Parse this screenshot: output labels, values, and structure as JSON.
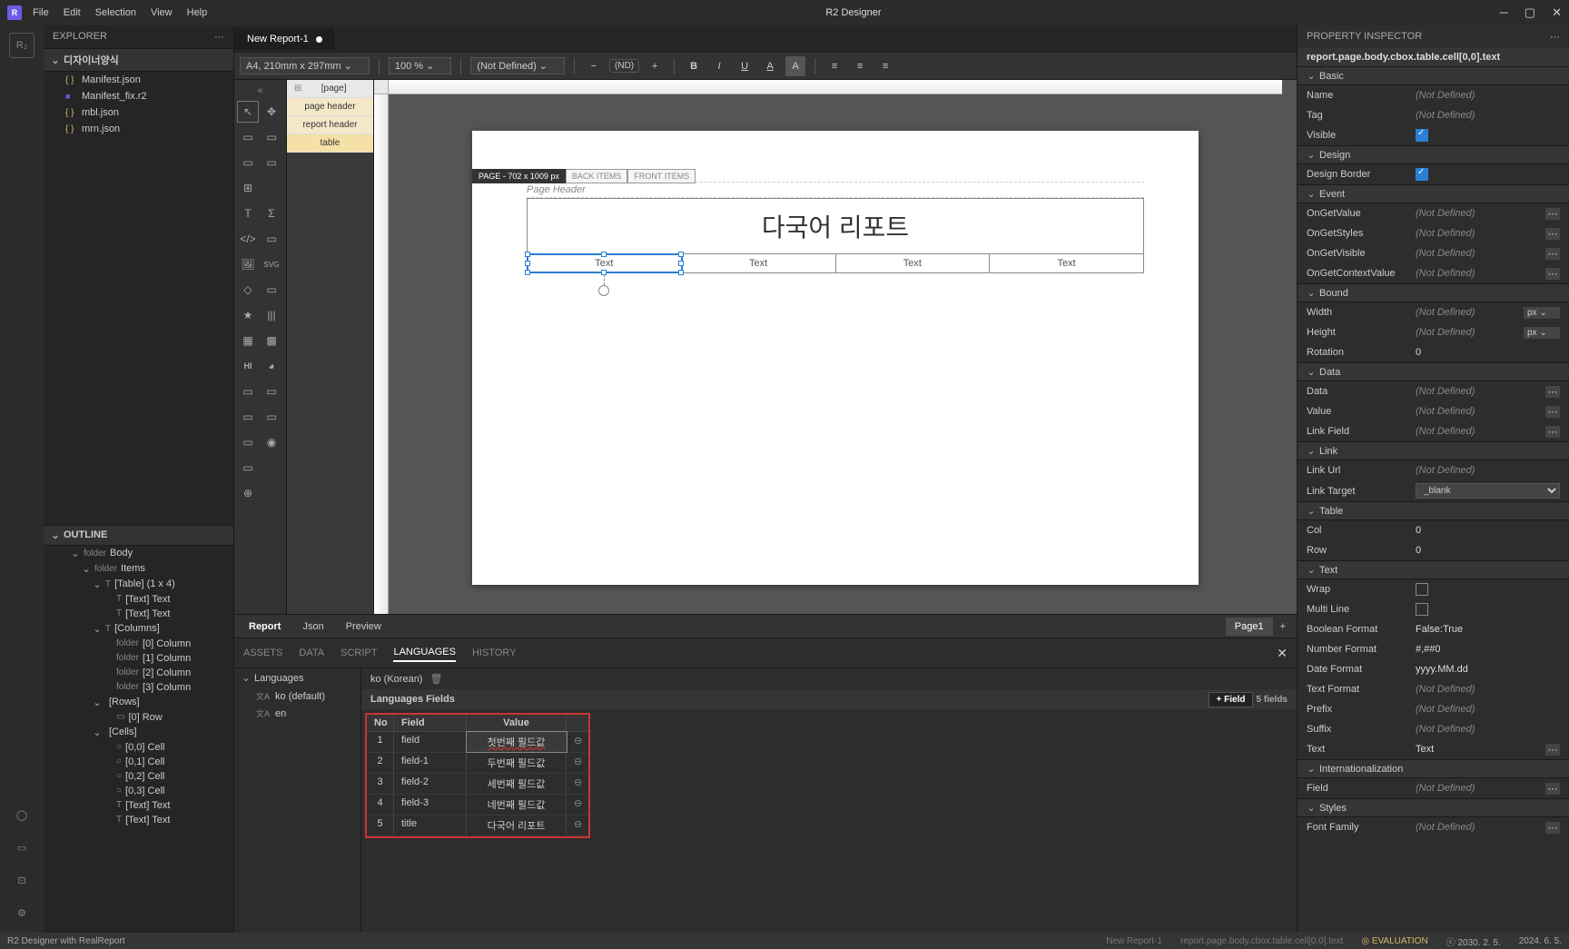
{
  "app": {
    "title": "R2 Designer"
  },
  "menu": [
    "File",
    "Edit",
    "Selection",
    "View",
    "Help"
  ],
  "tab": {
    "name": "New Report-1"
  },
  "toolbar": {
    "pageSize": "A4, 210mm x 297mm",
    "zoom": "100 %",
    "style": "(Not Defined)",
    "nd": "(ND)"
  },
  "explorer": {
    "title": "EXPLORER",
    "section": "디자이너양식",
    "files": [
      {
        "name": "Manifest.json",
        "type": "json"
      },
      {
        "name": "Manifest_fix.r2",
        "type": "r2"
      },
      {
        "name": "mbl.json",
        "type": "json"
      },
      {
        "name": "mrn.json",
        "type": "json"
      }
    ]
  },
  "outline": {
    "title": "OUTLINE",
    "items": [
      {
        "label": "Body",
        "icon": "folder",
        "ind": 2,
        "chev": true
      },
      {
        "label": "Items",
        "icon": "folder",
        "ind": 3,
        "chev": true
      },
      {
        "label": "[Table] (1 x 4)",
        "icon": "T",
        "ind": 4,
        "chev": true
      },
      {
        "label": "[Text] Text",
        "icon": "T",
        "ind": 5
      },
      {
        "label": "[Text] Text",
        "icon": "T",
        "ind": 5
      },
      {
        "label": "[Columns]",
        "icon": "T",
        "ind": 4,
        "chev": true
      },
      {
        "label": "[0] Column",
        "icon": "folder",
        "ind": 5
      },
      {
        "label": "[1] Column",
        "icon": "folder",
        "ind": 5
      },
      {
        "label": "[2] Column",
        "icon": "folder",
        "ind": 5
      },
      {
        "label": "[3] Column",
        "icon": "folder",
        "ind": 5
      },
      {
        "label": "[Rows]",
        "icon": "",
        "ind": 4,
        "chev": true
      },
      {
        "label": "[0] Row",
        "icon": "▭",
        "ind": 5
      },
      {
        "label": "[Cells]",
        "icon": "",
        "ind": 4,
        "chev": true
      },
      {
        "label": "[0,0] Cell",
        "icon": "○",
        "ind": 5
      },
      {
        "label": "[0,1] Cell",
        "icon": "○",
        "ind": 5
      },
      {
        "label": "[0,2] Cell",
        "icon": "○",
        "ind": 5
      },
      {
        "label": "[0,3] Cell",
        "icon": "○",
        "ind": 5
      },
      {
        "label": "[Text] Text",
        "icon": "T",
        "ind": 5
      },
      {
        "label": "[Text] Text",
        "icon": "T",
        "ind": 5
      }
    ]
  },
  "pageOutline": [
    "[page]",
    "page header",
    "report header",
    "table"
  ],
  "canvas": {
    "pageBadge": "PAGE - 702 x 1009 px",
    "backItems": "BACK ITEMS",
    "frontItems": "FRONT ITEMS",
    "pageHeader": "Page Header",
    "title": "다국어 리포트",
    "cells": [
      "Text",
      "Text",
      "Text",
      "Text"
    ]
  },
  "bottomTabs": {
    "tabs": [
      "Report",
      "Json",
      "Preview"
    ],
    "page": "Page1"
  },
  "bottomPanel": {
    "tabs": [
      "ASSETS",
      "DATA",
      "SCRIPT",
      "LANGUAGES",
      "HISTORY"
    ],
    "languagesHeader": "Languages",
    "langs": [
      {
        "label": "ko (default)"
      },
      {
        "label": "en"
      }
    ],
    "currentLang": "ko (Korean)",
    "fieldsHeader": "Languages Fields",
    "addField": "+ Field",
    "count": "5 fields",
    "th": {
      "no": "No",
      "field": "Field",
      "value": "Value"
    },
    "rows": [
      {
        "no": "1",
        "field": "field",
        "value": "첫번째 필드값",
        "editing": true
      },
      {
        "no": "2",
        "field": "field-1",
        "value": "두번째 필드값"
      },
      {
        "no": "3",
        "field": "field-2",
        "value": "세번째 필드값"
      },
      {
        "no": "4",
        "field": "field-3",
        "value": "네번째 필드값"
      },
      {
        "no": "5",
        "field": "title",
        "value": "다국어 리포트"
      }
    ]
  },
  "inspector": {
    "title": "PROPERTY INSPECTOR",
    "path": "report.page.body.cbox.table.cell[0,0].text",
    "sections": [
      {
        "header": "Basic",
        "rows": [
          {
            "label": "Name",
            "value": "(Not Defined)"
          },
          {
            "label": "Tag",
            "value": "(Not Defined)"
          },
          {
            "label": "Visible",
            "type": "check",
            "checked": true
          }
        ]
      },
      {
        "header": "Design",
        "rows": [
          {
            "label": "Design Border",
            "type": "check",
            "checked": true
          }
        ]
      },
      {
        "header": "Event",
        "rows": [
          {
            "label": "OnGetValue",
            "value": "(Not Defined)",
            "more": true
          },
          {
            "label": "OnGetStyles",
            "value": "(Not Defined)",
            "more": true
          },
          {
            "label": "OnGetVisible",
            "value": "(Not Defined)",
            "more": true
          },
          {
            "label": "OnGetContextValue",
            "value": "(Not Defined)",
            "more": true
          }
        ]
      },
      {
        "header": "Bound",
        "rows": [
          {
            "label": "Width",
            "value": "(Not Defined)",
            "unit": "px ⌄"
          },
          {
            "label": "Height",
            "value": "(Not Defined)",
            "unit": "px ⌄"
          },
          {
            "label": "Rotation",
            "value": "0",
            "set": true
          }
        ]
      },
      {
        "header": "Data",
        "rows": [
          {
            "label": "Data",
            "value": "(Not Defined)",
            "more": true
          },
          {
            "label": "Value",
            "value": "(Not Defined)",
            "more": true
          },
          {
            "label": "Link Field",
            "value": "(Not Defined)",
            "more": true
          }
        ]
      },
      {
        "header": "Link",
        "rows": [
          {
            "label": "Link Url",
            "value": "(Not Defined)"
          },
          {
            "label": "Link Target",
            "type": "select",
            "value": "_blank"
          }
        ]
      },
      {
        "header": "Table",
        "rows": [
          {
            "label": "Col",
            "value": "0",
            "set": true
          },
          {
            "label": "Row",
            "value": "0",
            "set": true
          }
        ]
      },
      {
        "header": "Text",
        "rows": [
          {
            "label": "Wrap",
            "type": "check",
            "checked": false
          },
          {
            "label": "Multi Line",
            "type": "check",
            "checked": false
          },
          {
            "label": "Boolean Format",
            "value": "False:True",
            "set": true
          },
          {
            "label": "Number Format",
            "value": "#,##0",
            "set": true
          },
          {
            "label": "Date Format",
            "value": "yyyy.MM.dd",
            "set": true
          },
          {
            "label": "Text Format",
            "value": "(Not Defined)"
          },
          {
            "label": "Prefix",
            "value": "(Not Defined)"
          },
          {
            "label": "Suffix",
            "value": "(Not Defined)"
          },
          {
            "label": "Text",
            "value": "Text",
            "set": true,
            "more": true
          }
        ]
      },
      {
        "header": "Internationalization",
        "rows": [
          {
            "label": "Field",
            "value": "(Not Defined)",
            "more": true
          }
        ]
      },
      {
        "header": "Styles",
        "rows": [
          {
            "label": "Font Family",
            "value": "(Not Defined)",
            "more": true
          }
        ]
      }
    ]
  },
  "status": {
    "left": "R2 Designer with RealReport",
    "doc": "New Report-1",
    "path": "report.page.body.cbox.table.cell[0,0].text",
    "eval": "◎ EVALUATION",
    "date1": "ⓒ 2030. 2. 5.",
    "date2": "2024. 6. 5."
  }
}
